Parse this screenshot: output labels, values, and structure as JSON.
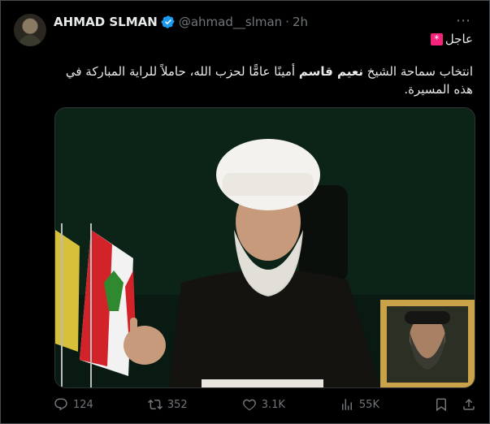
{
  "tweet": {
    "author_name": "AHMAD SLMAN",
    "handle": "@ahmad__slman",
    "separator": "·",
    "time": "2h",
    "more_icon": "⋯",
    "breaking_label": "عاجل",
    "breaking_emoji": "*",
    "text_before": "انتخاب سماحة الشيخ ",
    "text_bold": "نعيم قاسم",
    "text_after": " أمينًا عامًّا لحزب الله، حاملاً للراية المباركة في هذه المسيرة.",
    "media_alt": "Video still of cleric speaking beside flags and a framed portrait"
  },
  "actions": {
    "replies": "124",
    "reposts": "352",
    "likes": "3.1K",
    "views": "55K"
  },
  "icons": {
    "verified": "verified-badge-icon",
    "reply": "reply-icon",
    "repost": "repost-icon",
    "like": "heart-icon",
    "views": "views-icon",
    "bookmark": "bookmark-icon",
    "share": "share-icon"
  },
  "colors": {
    "background": "#000000",
    "text": "#e7e9ea",
    "muted": "#71767b",
    "verified": "#1d9bf0",
    "breaking": "#f4247c"
  }
}
